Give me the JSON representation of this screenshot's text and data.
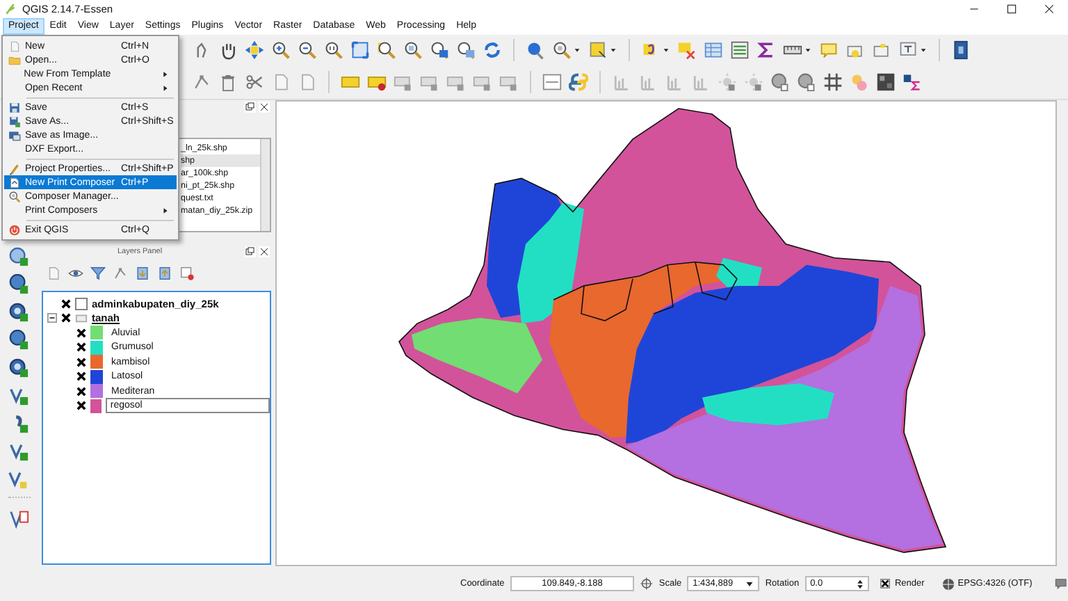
{
  "window": {
    "title": "QGIS 2.14.7-Essen"
  },
  "menu_bar": [
    {
      "label": "Project",
      "selected": true
    },
    {
      "label": "Edit",
      "selected": false
    },
    {
      "label": "View",
      "selected": false
    },
    {
      "label": "Layer",
      "selected": false
    },
    {
      "label": "Settings",
      "selected": false
    },
    {
      "label": "Plugins",
      "selected": false
    },
    {
      "label": "Vector",
      "selected": false
    },
    {
      "label": "Raster",
      "selected": false
    },
    {
      "label": "Database",
      "selected": false
    },
    {
      "label": "Web",
      "selected": false
    },
    {
      "label": "Processing",
      "selected": false
    },
    {
      "label": "Help",
      "selected": false
    }
  ],
  "project_menu": [
    {
      "kind": "item",
      "label": "New",
      "shortcut": "Ctrl+N",
      "selected": false
    },
    {
      "kind": "item",
      "label": "Open...",
      "shortcut": "Ctrl+O",
      "selected": false
    },
    {
      "kind": "submenu",
      "label": "New From Template",
      "selected": false
    },
    {
      "kind": "submenu",
      "label": "Open Recent",
      "selected": false
    },
    {
      "kind": "separator"
    },
    {
      "kind": "item",
      "label": "Save",
      "shortcut": "Ctrl+S",
      "selected": false
    },
    {
      "kind": "item",
      "label": "Save As...",
      "shortcut": "Ctrl+Shift+S",
      "selected": false
    },
    {
      "kind": "item",
      "label": "Save as Image...",
      "selected": false
    },
    {
      "kind": "item",
      "label": "DXF Export...",
      "selected": false
    },
    {
      "kind": "separator"
    },
    {
      "kind": "item",
      "label": "Project Properties...",
      "shortcut": "Ctrl+Shift+P",
      "selected": false
    },
    {
      "kind": "item",
      "label": "New Print Composer",
      "shortcut": "Ctrl+P",
      "selected": true
    },
    {
      "kind": "item",
      "label": "Composer Manager...",
      "selected": false
    },
    {
      "kind": "submenu",
      "label": "Print Composers",
      "selected": false
    },
    {
      "kind": "separator"
    },
    {
      "kind": "item",
      "label": "Exit QGIS",
      "shortcut": "Ctrl+Q",
      "selected": false
    }
  ],
  "browser_panel": {
    "items": [
      {
        "label": "_ln_25k.shp",
        "selected": false
      },
      {
        "label": "shp",
        "selected": true
      },
      {
        "label": "ar_100k.shp",
        "selected": false
      },
      {
        "label": "ni_pt_25k.shp",
        "selected": false
      },
      {
        "label": "quest.txt",
        "selected": false
      },
      {
        "label": "matan_diy_25k.zip",
        "selected": false
      }
    ]
  },
  "layers_panel": {
    "title": "Layers Panel",
    "layers": [
      {
        "name": "adminkabupaten_diy_25k",
        "checked": true,
        "selected": false
      },
      {
        "name": "tanah",
        "checked": true,
        "selected": true,
        "expanded": true,
        "children": [
          {
            "name": "Aluvial",
            "checked": true,
            "editing": false,
            "color": "#72dd72"
          },
          {
            "name": "Grumusol",
            "checked": true,
            "editing": false,
            "color": "#22dfc4"
          },
          {
            "name": "kambisol",
            "checked": true,
            "editing": false,
            "color": "#e8682e"
          },
          {
            "name": "Latosol",
            "checked": true,
            "editing": false,
            "color": "#1f45d8"
          },
          {
            "name": "Mediteran",
            "checked": true,
            "editing": false,
            "color": "#b46fe0"
          },
          {
            "name": "regosol",
            "checked": true,
            "editing": true,
            "color": "#d2539a"
          }
        ]
      }
    ]
  },
  "status_bar": {
    "coordinate_label": "Coordinate",
    "coordinate": "109.849,-8.188",
    "scale_label": "Scale",
    "scale": "1:434,889",
    "rotation_label": "Rotation",
    "rotation": "0.0",
    "render": {
      "label": "Render",
      "checked": true
    },
    "crs": "EPSG:4326 (OTF)"
  }
}
